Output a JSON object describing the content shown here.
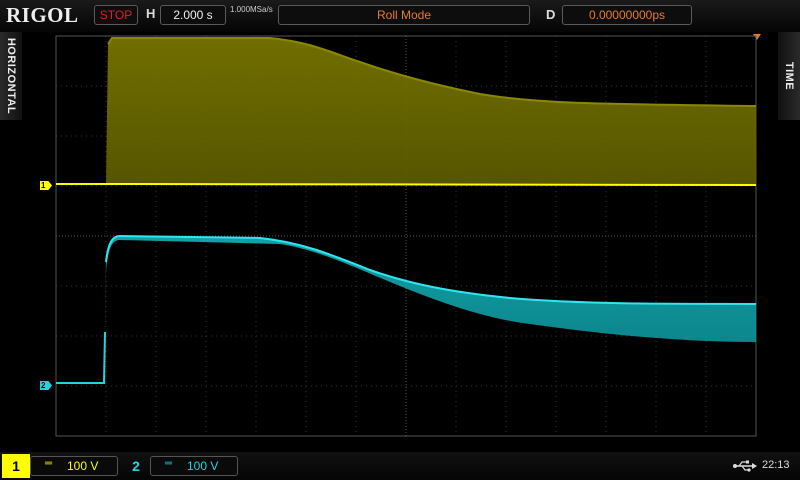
{
  "header": {
    "brand": "RIGOL",
    "run_state": "STOP",
    "timebase_label": "H",
    "timebase_value": "2.000 s",
    "sample_rate": "1.000MSa/s",
    "acquisition_mode": "Roll Mode",
    "delay_label": "D",
    "delay_value": "0.00000000ps"
  },
  "side_tabs": {
    "left": "HORIZONTAL",
    "right": "TIME"
  },
  "channels": [
    {
      "number": "1",
      "coupling": "═",
      "scale": "100 V",
      "color": "#ffff00"
    },
    {
      "number": "2",
      "coupling": "═",
      "scale": "100 V",
      "color": "#22d3e0"
    }
  ],
  "status": {
    "usb_icon": "usb-icon",
    "clock": "22:13"
  },
  "colors": {
    "ch1": "#ffff00",
    "ch1_envelope": "#6b6a00",
    "ch2": "#22d3e0",
    "ch2_envelope": "#0d8f94",
    "trigger": "#e87b2a",
    "stop": "#e02020"
  }
}
